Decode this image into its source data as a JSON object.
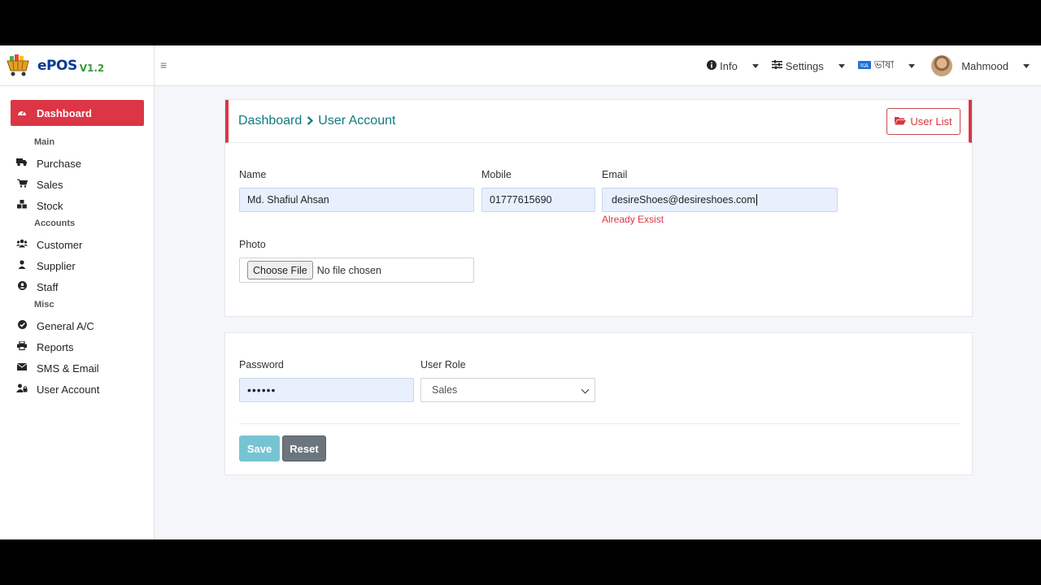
{
  "brand": {
    "name": "ePOS",
    "version": "V1.2",
    "logo_icon": "shopping-basket-icon"
  },
  "topnav": {
    "info_label": "Info",
    "settings_label": "Settings",
    "language_label": "ভাষা",
    "user_name": "Mahmood"
  },
  "sidebar": {
    "active_label": "Dashboard",
    "main_heading": "Main",
    "accounts_heading": "Accounts",
    "misc_heading": "Misc",
    "items": [
      {
        "label": "Purchase",
        "icon": "truck-icon"
      },
      {
        "label": "Sales",
        "icon": "cart-icon"
      },
      {
        "label": "Stock",
        "icon": "boxes-icon"
      },
      {
        "label": "Customer",
        "icon": "users-icon"
      },
      {
        "label": "Supplier",
        "icon": "user-icon"
      },
      {
        "label": "Staff",
        "icon": "user-circle-icon"
      },
      {
        "label": "General A/C",
        "icon": "check-circle-icon"
      },
      {
        "label": "Reports",
        "icon": "printer-icon"
      },
      {
        "label": "SMS & Email",
        "icon": "envelope-icon"
      },
      {
        "label": "User Account",
        "icon": "user-lock-icon"
      }
    ]
  },
  "header": {
    "crumb_root": "Dashboard",
    "crumb_current": "User Account",
    "user_list_label": "User List"
  },
  "form": {
    "name_label": "Name",
    "name_value": "Md. Shafiul Ahsan",
    "mobile_label": "Mobile",
    "mobile_value": "01777615690",
    "email_label": "Email",
    "email_value": "desireShoes@desireshoes.com",
    "email_error": "Already Exsist",
    "photo_label": "Photo",
    "file_button": "Choose File",
    "file_status": "No file chosen",
    "password_label": "Password",
    "password_value": "••••••",
    "role_label": "User Role",
    "role_value": "Sales",
    "save_label": "Save",
    "reset_label": "Reset"
  },
  "colors": {
    "accent": "#dc3545",
    "title": "#117a7f",
    "save": "#76c4d3",
    "reset": "#6c757d"
  }
}
